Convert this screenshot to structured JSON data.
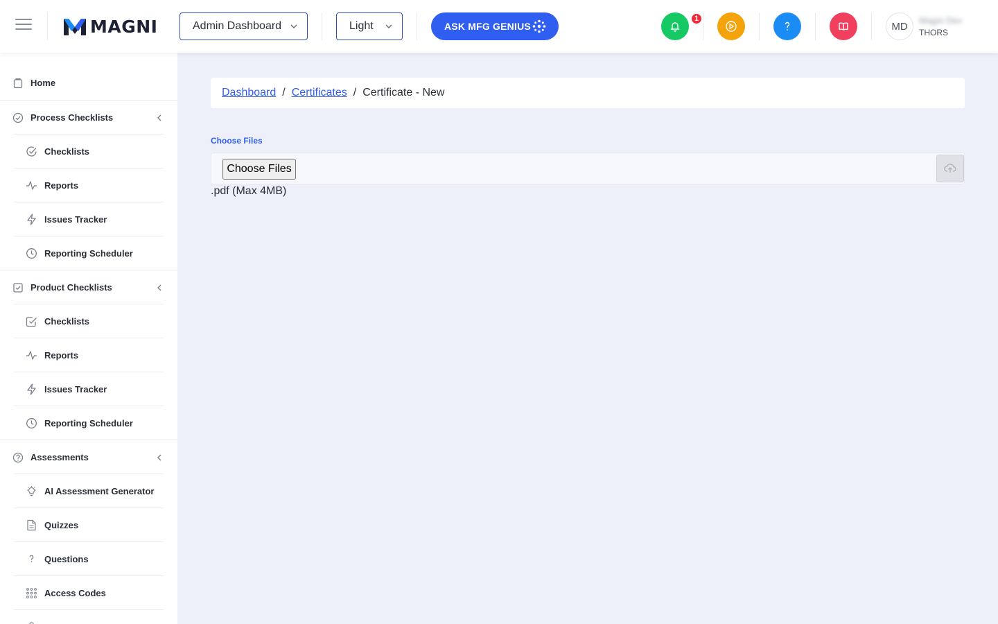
{
  "header": {
    "menu_icon": "hamburger-icon",
    "logo_text": "MAGNI",
    "dashboard_select": "Admin Dashboard",
    "theme_select": "Light",
    "ask_button": "ASK MFG GENIUS",
    "notification_count": "1",
    "avatar_initials": "MD",
    "user_name": "Magni Dev",
    "user_org": "THORS",
    "icons": [
      "bell-icon",
      "play-icon",
      "help-icon",
      "book-icon"
    ],
    "colors": {
      "bell": "#17c964",
      "play": "#f5a30a",
      "help": "#1a8cf3",
      "book": "#f0405e",
      "accent": "#2f5ef0"
    }
  },
  "sidebar": {
    "home": "Home",
    "process_checklists": {
      "label": "Process Checklists",
      "items": [
        "Checklists",
        "Reports",
        "Issues Tracker",
        "Reporting Scheduler"
      ]
    },
    "product_checklists": {
      "label": "Product Checklists",
      "items": [
        "Checklists",
        "Reports",
        "Issues Tracker",
        "Reporting Scheduler"
      ]
    },
    "assessments": {
      "label": "Assessments",
      "items": [
        "AI Assessment Generator",
        "Quizzes",
        "Questions",
        "Access Codes"
      ]
    }
  },
  "breadcrumb": {
    "dashboard": "Dashboard",
    "certificates": "Certificates",
    "current": "Certificate - New",
    "separator": "/"
  },
  "form": {
    "field_label": "Choose Files",
    "file_button": "Choose Files",
    "hint": ".pdf (Max 4MB)"
  }
}
